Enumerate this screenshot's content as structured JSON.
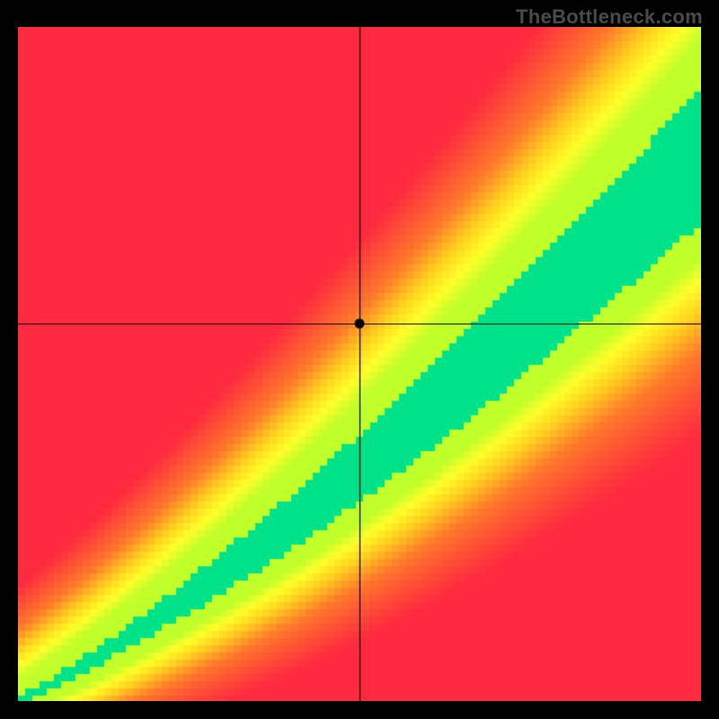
{
  "watermark": "TheBottleneck.com",
  "chart_data": {
    "type": "heatmap",
    "title": "",
    "xlabel": "",
    "ylabel": "",
    "x_range": [
      0,
      100
    ],
    "y_range": [
      0,
      100
    ],
    "crosshair": {
      "x": 50,
      "y": 56
    },
    "marker": {
      "x": 50,
      "y": 56
    },
    "ideal_curve_note": "green band follows y ≈ 0.7·x with slight convexity; width grows with x",
    "color_scale": {
      "0.0": "#ff2a3f",
      "0.35": "#ff7a2a",
      "0.55": "#ffd21e",
      "0.70": "#ffff2a",
      "0.85": "#b2ff2a",
      "1.0": "#00e28a"
    },
    "ideal_curve_samples": [
      {
        "x": 0,
        "y": 0.0
      },
      {
        "x": 10,
        "y": 5.5
      },
      {
        "x": 20,
        "y": 12.0
      },
      {
        "x": 30,
        "y": 19.0
      },
      {
        "x": 40,
        "y": 26.5
      },
      {
        "x": 50,
        "y": 34.5
      },
      {
        "x": 60,
        "y": 43.0
      },
      {
        "x": 70,
        "y": 52.0
      },
      {
        "x": 80,
        "y": 61.5
      },
      {
        "x": 90,
        "y": 71.0
      },
      {
        "x": 100,
        "y": 81.0
      }
    ],
    "band_halfwidth_samples": [
      {
        "x": 0,
        "w": 0.5
      },
      {
        "x": 20,
        "w": 2.0
      },
      {
        "x": 40,
        "w": 4.0
      },
      {
        "x": 60,
        "w": 6.0
      },
      {
        "x": 80,
        "w": 8.0
      },
      {
        "x": 100,
        "w": 10.0
      }
    ]
  }
}
